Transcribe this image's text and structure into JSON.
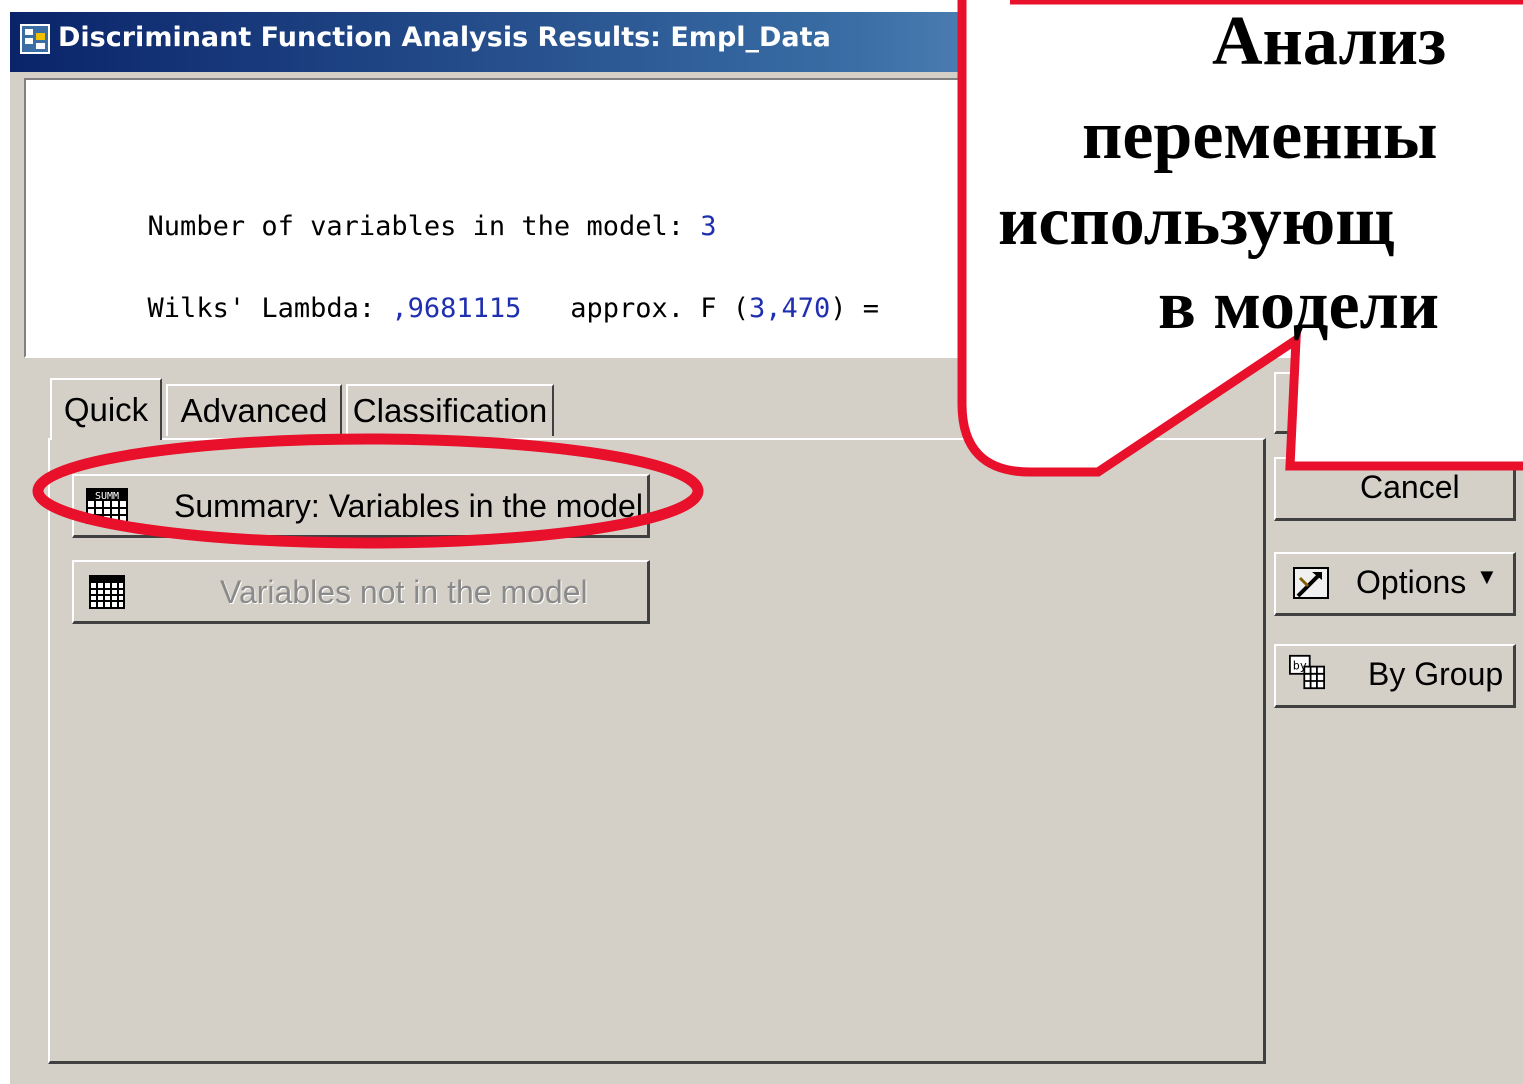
{
  "window": {
    "title": "Discriminant Function Analysis Results: Empl_Data"
  },
  "output": {
    "line1_label": "Number of variables in the model: ",
    "line1_value": "3",
    "line2_label": "Wilks' Lambda: ",
    "line2_value": ",9681115",
    "line2_mid": "   approx. F (",
    "line2_df": "3,470",
    "line2_tail": ") ="
  },
  "tabs": [
    {
      "label": "Quick",
      "active": true
    },
    {
      "label": "Advanced",
      "active": false
    },
    {
      "label": "Classification",
      "active": false
    }
  ],
  "buttons": {
    "summary_label": "Summary:  Variables in the model",
    "summary_icon_text": "SUMM",
    "not_in_model_label": "Variables not in the model",
    "cancel_label": "Cancel",
    "options_label": "Options",
    "by_group_label": "By Group",
    "by_group_icon_text": "by"
  },
  "callout": {
    "line1": "Анализ",
    "line2": "переменны",
    "line3": "использующ",
    "line4": "в модели"
  },
  "colors": {
    "callout_border": "#e8102a",
    "highlight_ellipse": "#e8102a",
    "title_bar": "#0a246a",
    "window_face": "#d4d0c8",
    "number_text": "#1f2fb0"
  }
}
